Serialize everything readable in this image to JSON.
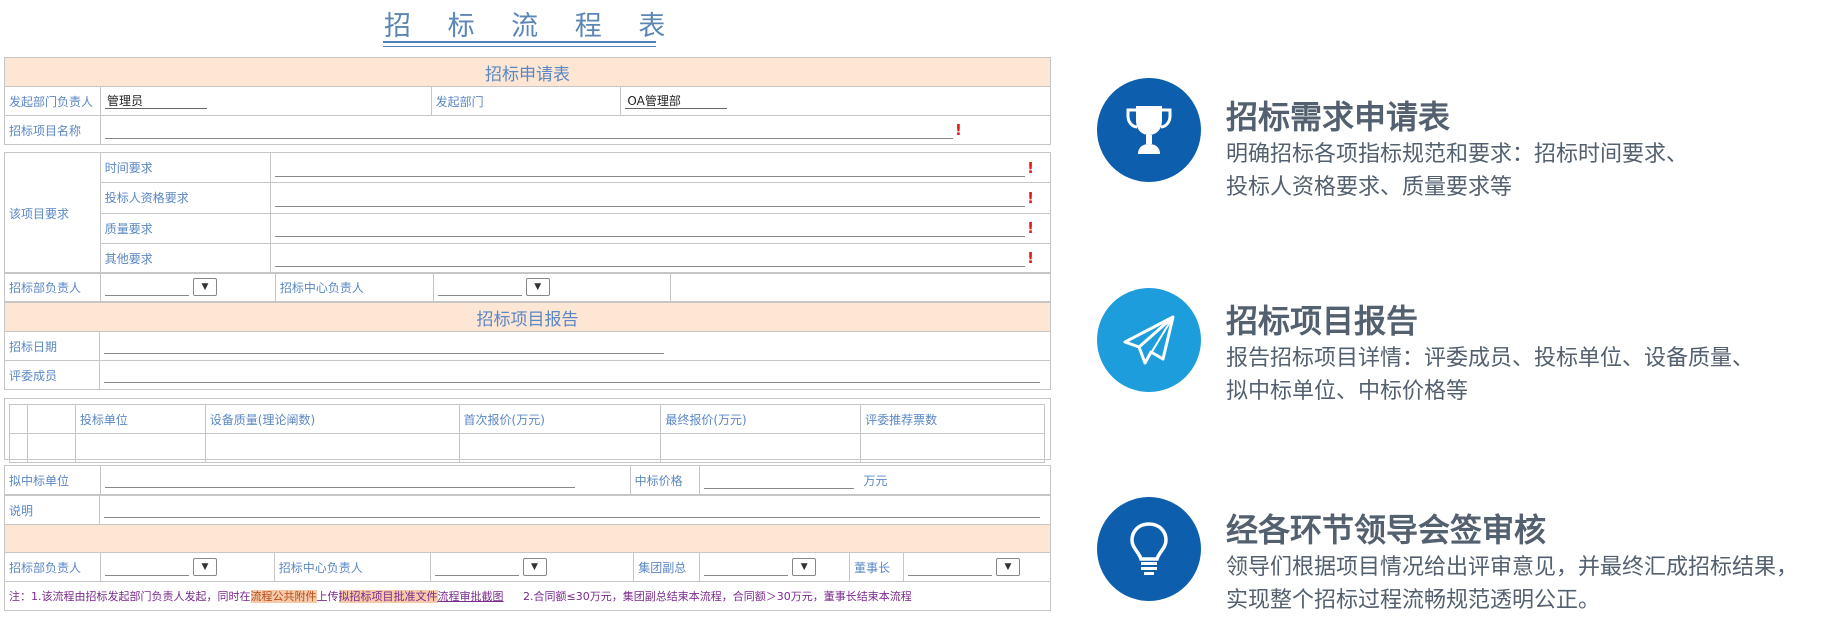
{
  "header": {
    "title": "招 标 流 程 表"
  },
  "form": {
    "section_apply": "招标申请表",
    "initiator_label": "发起部门负责人",
    "initiator_value": "管理员",
    "dept_label": "发起部门",
    "dept_value": "OA管理部",
    "project_name_label": "招标项目名称",
    "requirements_label": "该项目要求",
    "req_time": "时间要求",
    "req_bidder": "投标人资格要求",
    "req_quality": "质量要求",
    "req_other": "其他要求",
    "bid_dept_head": "招标部负责人",
    "bid_center_head": "招标中心负责人",
    "required_mark": "!",
    "select_arrow": "▼",
    "section_report": "招标项目报告",
    "bid_date": "招标日期",
    "jury": "评委成员",
    "col_bidder": "投标单位",
    "col_quality": "设备质量(理论阐数)",
    "col_first_price": "首次报价(万元)",
    "col_final_price": "最终报价(万元)",
    "col_votes": "评委推荐票数",
    "winner_unit": "拟中标单位",
    "winning_price": "中标价格",
    "price_unit": "万元",
    "remark": "说明",
    "group_vp": "集团副总",
    "chairman": "董事长",
    "note_a": "注：1.该流程由招标发起部门负责人发起，同时在",
    "note_hl1": "流程公共附件",
    "note_b": "上传",
    "note_hl2": "拟招标项目批准文件",
    "note_link": "流程审批截图",
    "note_c": "2.合同额≤30万元，集团副总结束本流程，合同额＞30万元，董事长结束本流程"
  },
  "features": [
    {
      "icon": "trophy-icon",
      "color": "#0d5fae",
      "title": "招标需求申请表",
      "line1": "明确招标各项指标规范和要求：招标时间要求、",
      "line2": "投标人资格要求、质量要求等"
    },
    {
      "icon": "paper-plane-icon",
      "color": "#1d9ddc",
      "title": "招标项目报告",
      "line1": "报告招标项目详情：评委成员、投标单位、设备质量、",
      "line2": "拟中标单位、中标价格等"
    },
    {
      "icon": "lightbulb-icon",
      "color": "#0d5fae",
      "title": "经各环节领导会签审核",
      "line1": "领导们根据项目情况给出评审意见，并最终汇成招标结果，",
      "line2": "实现整个招标过程流畅规范透明公正。"
    }
  ]
}
